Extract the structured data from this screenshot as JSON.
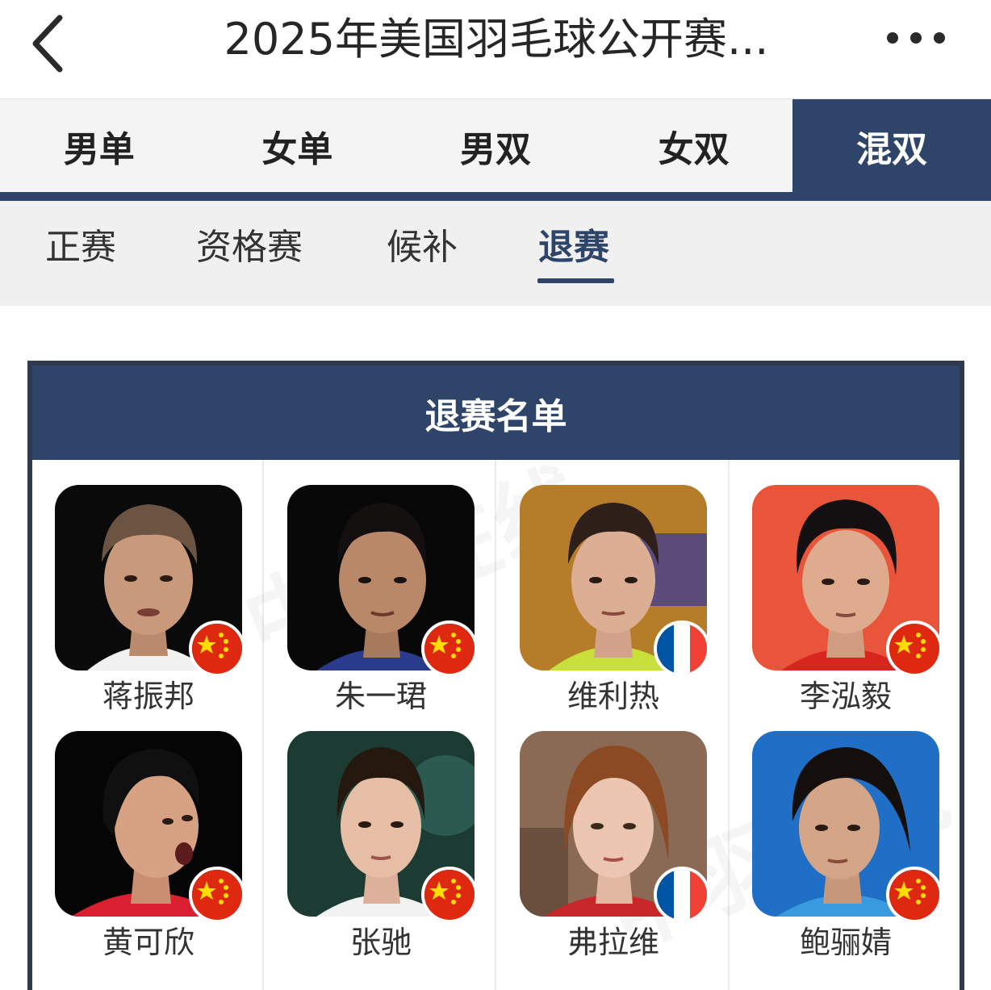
{
  "header": {
    "title": "2025年美国羽毛球公开赛...",
    "back_icon": "chevron-left-icon",
    "more_icon": "more-dots-icon"
  },
  "event_tabs": [
    {
      "label": "男单",
      "active": false
    },
    {
      "label": "女单",
      "active": false
    },
    {
      "label": "男双",
      "active": false
    },
    {
      "label": "女双",
      "active": false
    },
    {
      "label": "混双",
      "active": true
    }
  ],
  "sub_tabs": [
    {
      "label": "正赛",
      "active": false
    },
    {
      "label": "资格赛",
      "active": false
    },
    {
      "label": "候补",
      "active": false
    },
    {
      "label": "退赛",
      "active": true
    }
  ],
  "card": {
    "title": "退赛名单"
  },
  "players": [
    {
      "name": "蒋振邦",
      "country_flag": "china-flag-icon"
    },
    {
      "name": "朱一珺",
      "country_flag": "china-flag-icon"
    },
    {
      "name": "维利热",
      "country_flag": "france-flag-icon"
    },
    {
      "name": "李泓毅",
      "country_flag": "china-flag-icon"
    },
    {
      "name": "黄可欣",
      "country_flag": "china-flag-icon"
    },
    {
      "name": "张驰",
      "country_flag": "china-flag-icon"
    },
    {
      "name": "弗拉维",
      "country_flag": "france-flag-icon"
    },
    {
      "name": "鲍骊婧",
      "country_flag": "china-flag-icon"
    }
  ],
  "colors": {
    "primary": "#2e4468",
    "china_red": "#de2910",
    "china_yellow": "#ffde00",
    "france_blue": "#0055a4",
    "france_red": "#ef4135"
  }
}
